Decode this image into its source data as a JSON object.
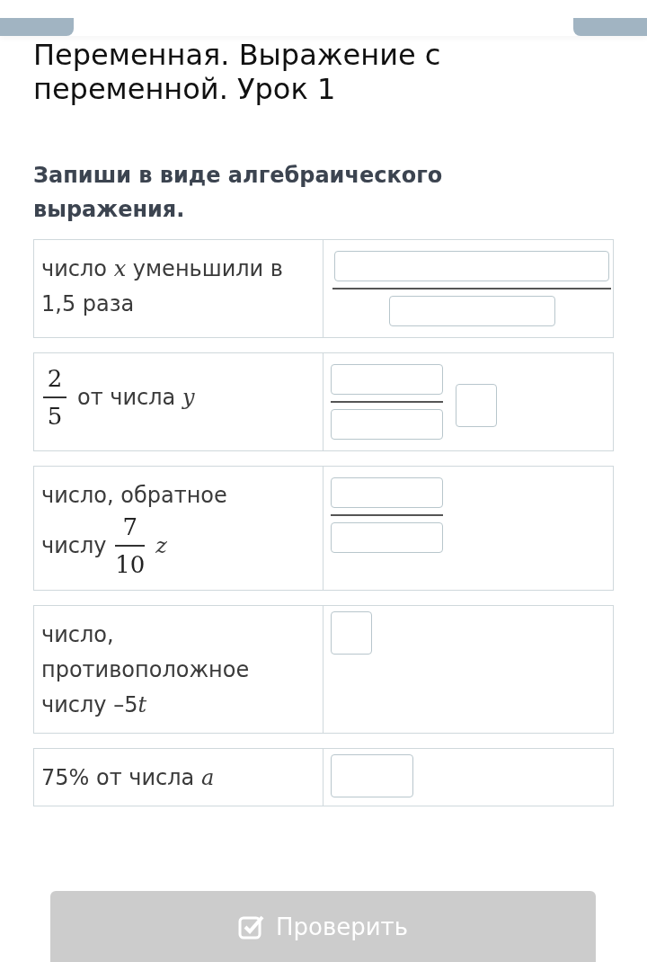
{
  "title": "Переменная. Выражение с переменной. Урок 1",
  "instruction": "Запиши в виде алгебраического выражения.",
  "tasks": [
    {
      "prompt": [
        {
          "kind": "text",
          "text": "число *x* уменьшили в 1,5 раза"
        }
      ],
      "answer": {
        "kind": "fraction-wide"
      }
    },
    {
      "prompt": [
        {
          "kind": "fraction",
          "numerator": "2",
          "denominator": "5"
        },
        {
          "kind": "text",
          "text": "от числа *y*"
        }
      ],
      "answer": {
        "kind": "mixed"
      }
    },
    {
      "prompt": [
        {
          "kind": "text",
          "text": "число, обратное"
        },
        {
          "kind": "break"
        },
        {
          "kind": "text",
          "text": "числу"
        },
        {
          "kind": "fraction",
          "numerator": "7",
          "denominator": "10"
        },
        {
          "kind": "text",
          "text": "*z*"
        }
      ],
      "answer": {
        "kind": "fraction"
      }
    },
    {
      "prompt": [
        {
          "kind": "text",
          "text": "число, противоположное числу –5"
        },
        {
          "kind": "var",
          "text": "t"
        }
      ],
      "answer": {
        "kind": "box"
      }
    },
    {
      "prompt": [
        {
          "kind": "text",
          "text": "75% от числа *a*"
        }
      ],
      "answer": {
        "kind": "box-wide"
      }
    }
  ],
  "check_button": {
    "label": "Проверить",
    "disabled": true
  }
}
